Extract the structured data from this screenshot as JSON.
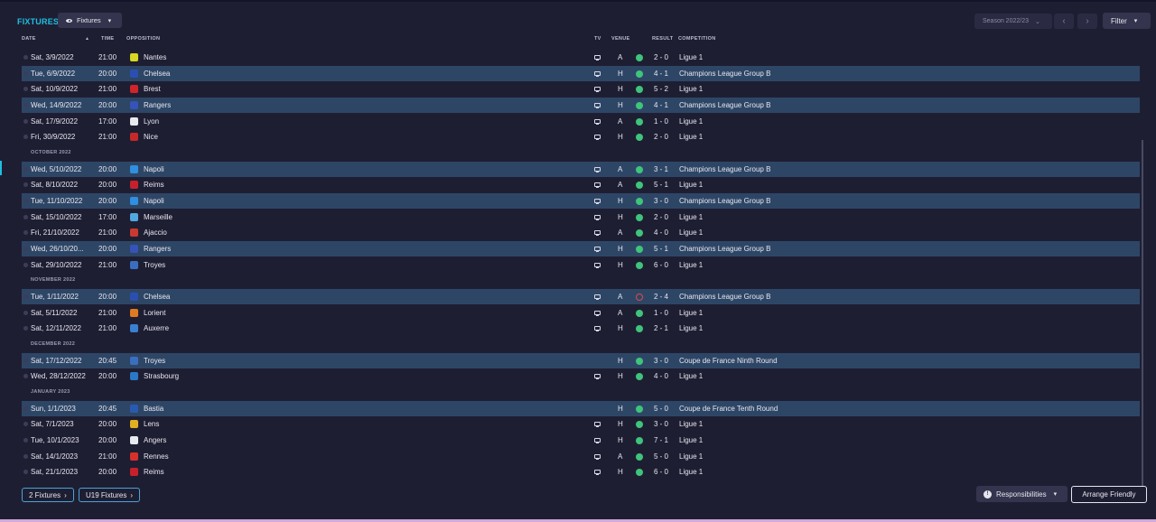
{
  "header": {
    "title": "FIXTURES",
    "view_label": "Fixtures",
    "season_label": "Season 2022/23",
    "filter_label": "Filter"
  },
  "columns": {
    "date": "DATE",
    "time": "TIME",
    "opposition": "OPPOSITION",
    "tv": "TV",
    "venue": "VENUE",
    "result": "RESULT",
    "competition": "COMPETITION"
  },
  "rows": [
    {
      "kind": "match",
      "date": "Sat, 3/9/2022",
      "time": "21:00",
      "opponent": "Nantes",
      "crest": "#d8d820",
      "tv": true,
      "venue": "A",
      "outcome": "win",
      "result": "2 - 0",
      "competition": "Ligue 1",
      "hl": false
    },
    {
      "kind": "match",
      "date": "Tue, 6/9/2022",
      "time": "20:00",
      "opponent": "Chelsea",
      "crest": "#2b4fb0",
      "tv": true,
      "venue": "H",
      "outcome": "win",
      "result": "4 - 1",
      "competition": "Champions League Group B",
      "hl": true
    },
    {
      "kind": "match",
      "date": "Sat, 10/9/2022",
      "time": "21:00",
      "opponent": "Brest",
      "crest": "#d0242a",
      "tv": true,
      "venue": "H",
      "outcome": "win",
      "result": "5 - 2",
      "competition": "Ligue 1",
      "hl": false
    },
    {
      "kind": "match",
      "date": "Wed, 14/9/2022",
      "time": "20:00",
      "opponent": "Rangers",
      "crest": "#3553b8",
      "tv": true,
      "venue": "H",
      "outcome": "win",
      "result": "4 - 1",
      "competition": "Champions League Group B",
      "hl": true
    },
    {
      "kind": "match",
      "date": "Sat, 17/9/2022",
      "time": "17:00",
      "opponent": "Lyon",
      "crest": "#e8e8f0",
      "tv": true,
      "venue": "A",
      "outcome": "win",
      "result": "1 - 0",
      "competition": "Ligue 1",
      "hl": false
    },
    {
      "kind": "match",
      "date": "Fri, 30/9/2022",
      "time": "21:00",
      "opponent": "Nice",
      "crest": "#c62828",
      "tv": true,
      "venue": "H",
      "outcome": "win",
      "result": "2 - 0",
      "competition": "Ligue 1",
      "hl": false
    },
    {
      "kind": "month",
      "label": "OCTOBER 2022"
    },
    {
      "kind": "match",
      "date": "Wed, 5/10/2022",
      "time": "20:00",
      "opponent": "Napoli",
      "crest": "#2f8fe0",
      "tv": true,
      "venue": "A",
      "outcome": "win",
      "result": "3 - 1",
      "competition": "Champions League Group B",
      "hl": true
    },
    {
      "kind": "match",
      "date": "Sat, 8/10/2022",
      "time": "20:00",
      "opponent": "Reims",
      "crest": "#c8202a",
      "tv": true,
      "venue": "A",
      "outcome": "win",
      "result": "5 - 1",
      "competition": "Ligue 1",
      "hl": false
    },
    {
      "kind": "match",
      "date": "Tue, 11/10/2022",
      "time": "20:00",
      "opponent": "Napoli",
      "crest": "#2f8fe0",
      "tv": true,
      "venue": "H",
      "outcome": "win",
      "result": "3 - 0",
      "competition": "Champions League Group B",
      "hl": true
    },
    {
      "kind": "match",
      "date": "Sat, 15/10/2022",
      "time": "17:00",
      "opponent": "Marseille",
      "crest": "#52a7e0",
      "tv": true,
      "venue": "H",
      "outcome": "win",
      "result": "2 - 0",
      "competition": "Ligue 1",
      "hl": false
    },
    {
      "kind": "match",
      "date": "Fri, 21/10/2022",
      "time": "21:00",
      "opponent": "Ajaccio",
      "crest": "#c83a30",
      "tv": true,
      "venue": "A",
      "outcome": "win",
      "result": "4 - 0",
      "competition": "Ligue 1",
      "hl": false
    },
    {
      "kind": "match",
      "date": "Wed, 26/10/20...",
      "time": "20:00",
      "opponent": "Rangers",
      "crest": "#3553b8",
      "tv": true,
      "venue": "H",
      "outcome": "win",
      "result": "5 - 1",
      "competition": "Champions League Group B",
      "hl": true
    },
    {
      "kind": "match",
      "date": "Sat, 29/10/2022",
      "time": "21:00",
      "opponent": "Troyes",
      "crest": "#3a6fc0",
      "tv": true,
      "venue": "H",
      "outcome": "win",
      "result": "6 - 0",
      "competition": "Ligue 1",
      "hl": false
    },
    {
      "kind": "month",
      "label": "NOVEMBER 2022"
    },
    {
      "kind": "match",
      "date": "Tue, 1/11/2022",
      "time": "20:00",
      "opponent": "Chelsea",
      "crest": "#2b4fb0",
      "tv": true,
      "venue": "A",
      "outcome": "loss",
      "result": "2 - 4",
      "competition": "Champions League Group B",
      "hl": true
    },
    {
      "kind": "match",
      "date": "Sat, 5/11/2022",
      "time": "21:00",
      "opponent": "Lorient",
      "crest": "#e07a20",
      "tv": true,
      "venue": "A",
      "outcome": "win",
      "result": "1 - 0",
      "competition": "Ligue 1",
      "hl": false
    },
    {
      "kind": "match",
      "date": "Sat, 12/11/2022",
      "time": "21:00",
      "opponent": "Auxerre",
      "crest": "#3a7fd0",
      "tv": true,
      "venue": "H",
      "outcome": "win",
      "result": "2 - 1",
      "competition": "Ligue 1",
      "hl": false
    },
    {
      "kind": "month",
      "label": "DECEMBER 2022"
    },
    {
      "kind": "match",
      "date": "Sat, 17/12/2022",
      "time": "20:45",
      "opponent": "Troyes",
      "crest": "#3a6fc0",
      "tv": false,
      "venue": "H",
      "outcome": "win",
      "result": "3 - 0",
      "competition": "Coupe de France Ninth Round",
      "hl": true
    },
    {
      "kind": "match",
      "date": "Wed, 28/12/2022",
      "time": "20:00",
      "opponent": "Strasbourg",
      "crest": "#2a78c8",
      "tv": true,
      "venue": "H",
      "outcome": "win",
      "result": "4 - 0",
      "competition": "Ligue 1",
      "hl": false
    },
    {
      "kind": "month",
      "label": "JANUARY 2023"
    },
    {
      "kind": "match",
      "date": "Sun, 1/1/2023",
      "time": "20:45",
      "opponent": "Bastia",
      "crest": "#2a5ab0",
      "tv": false,
      "venue": "H",
      "outcome": "win",
      "result": "5 - 0",
      "competition": "Coupe de France Tenth Round",
      "hl": true
    },
    {
      "kind": "match",
      "date": "Sat, 7/1/2023",
      "time": "20:00",
      "opponent": "Lens",
      "crest": "#e0b020",
      "tv": true,
      "venue": "H",
      "outcome": "win",
      "result": "3 - 0",
      "competition": "Ligue 1",
      "hl": false
    },
    {
      "kind": "match",
      "date": "Tue, 10/1/2023",
      "time": "20:00",
      "opponent": "Angers",
      "crest": "#e8e8f0",
      "tv": true,
      "venue": "H",
      "outcome": "win",
      "result": "7 - 1",
      "competition": "Ligue 1",
      "hl": false
    },
    {
      "kind": "match",
      "date": "Sat, 14/1/2023",
      "time": "21:00",
      "opponent": "Rennes",
      "crest": "#d8302a",
      "tv": true,
      "venue": "A",
      "outcome": "win",
      "result": "5 - 0",
      "competition": "Ligue 1",
      "hl": false
    },
    {
      "kind": "match",
      "date": "Sat, 21/1/2023",
      "time": "20:00",
      "opponent": "Reims",
      "crest": "#c8202a",
      "tv": true,
      "venue": "H",
      "outcome": "win",
      "result": "6 - 0",
      "competition": "Ligue 1",
      "hl": false
    }
  ],
  "footer": {
    "fixtures_pill": "2 Fixtures",
    "u19_pill": "U19 Fixtures",
    "responsibilities_label": "Responsibilities",
    "arrange_label": "Arrange Friendly"
  },
  "colors": {
    "accent": "#1fbfe0",
    "win": "#3ec47b",
    "loss": "#e04848",
    "row_highlight": "#2e4666"
  }
}
